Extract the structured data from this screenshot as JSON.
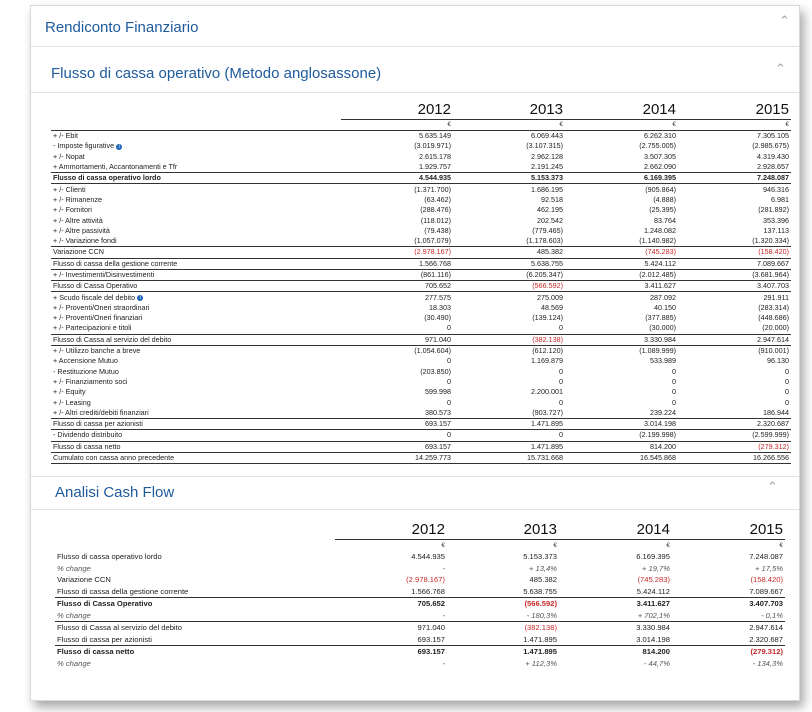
{
  "panel_title": "Rendiconto Finanziario",
  "section1_title": "Flusso di cassa operativo (Metodo anglosassone)",
  "section2_title": "Analisi Cash Flow",
  "years": [
    "2012",
    "2013",
    "2014",
    "2015"
  ],
  "currency": "€",
  "icons": {
    "collapse": "chevron-up-icon",
    "info": "info-icon"
  },
  "colors": {
    "header": "#1e5a9c",
    "negative": "#c62828"
  },
  "table1": [
    {
      "label": "+ /- Ebit",
      "v": [
        "5.635.149",
        "6.069.443",
        "6.262.310",
        "7.305.105"
      ],
      "tl": true
    },
    {
      "label": "- Imposte figurative",
      "info": true,
      "v": [
        "(3.019.971)",
        "(3.107.315)",
        "(2.755.005)",
        "(2.985.675)"
      ]
    },
    {
      "label": "+ /- Nopat",
      "v": [
        "2.615.178",
        "2.962.128",
        "3.507.305",
        "4.319.430"
      ]
    },
    {
      "label": "+ Ammortamenti, Accantonamenti e Tfr",
      "v": [
        "1.929.757",
        "2.191.245",
        "2.662.090",
        "2.928.657"
      ]
    },
    {
      "label": "Flusso di cassa operativo lordo",
      "v": [
        "4.544.935",
        "5.153.373",
        "6.169.395",
        "7.248.087"
      ],
      "b": true,
      "tl": true,
      "bl": true
    },
    {
      "label": "+ /- Clienti",
      "v": [
        "(1.371.700)",
        "1.686.195",
        "(905.864)",
        "946.316"
      ]
    },
    {
      "label": "+ /- Rimanenze",
      "v": [
        "(63.462)",
        "92.518",
        "(4.888)",
        "6.981"
      ]
    },
    {
      "label": "+ /- Fornitori",
      "v": [
        "(288.476)",
        "462.195",
        "(25.395)",
        "(281.892)"
      ]
    },
    {
      "label": "+ /- Altre attività",
      "v": [
        "(118.012)",
        "202.542",
        "83.764",
        "353.396"
      ]
    },
    {
      "label": "+ /- Altre passività",
      "v": [
        "(79.438)",
        "(779.465)",
        "1.248.082",
        "137.113"
      ]
    },
    {
      "label": "+ /- Variazione fondi",
      "v": [
        "(1.057.079)",
        "(1.178.603)",
        "(1.140.982)",
        "(1.320.334)"
      ]
    },
    {
      "label": "Variazione CCN",
      "v": [
        "(2.978.167)",
        "485.382",
        "(745.283)",
        "(158.420)"
      ],
      "neg": [
        true,
        false,
        true,
        true
      ],
      "tl": true,
      "bl": true
    },
    {
      "label": "Flusso di cassa della gestione corrente",
      "v": [
        "1.566.768",
        "5.638.755",
        "5.424.112",
        "7.089.667"
      ],
      "bl": true
    },
    {
      "label": "+ /- Investimenti/Disinvestimenti",
      "v": [
        "(861.116)",
        "(6.205.347)",
        "(2.012.485)",
        "(3.681.964)"
      ],
      "bl": true
    },
    {
      "label": "Flusso di Cassa Operativo",
      "v": [
        "705.652",
        "(566.592)",
        "3.411.627",
        "3.407.703"
      ],
      "neg": [
        false,
        true,
        false,
        false
      ],
      "bl": true
    },
    {
      "label": "+ Scudo fiscale del debito",
      "info": true,
      "v": [
        "277.575",
        "275.009",
        "287.092",
        "291.911"
      ]
    },
    {
      "label": "+ /- Proventi/Oneri straordinari",
      "v": [
        "18.303",
        "48.569",
        "40.150",
        "(283.314)"
      ]
    },
    {
      "label": "+ /- Proventi/Oneri finanziari",
      "v": [
        "(30.490)",
        "(139.124)",
        "(377.885)",
        "(448.686)"
      ]
    },
    {
      "label": "+ /- Partecipazioni e titoli",
      "v": [
        "0",
        "0",
        "(30.000)",
        "(20.000)"
      ]
    },
    {
      "label": "Flusso di Cassa al servizio del debito",
      "v": [
        "971.040",
        "(382.138)",
        "3.330.984",
        "2.947.614"
      ],
      "neg": [
        false,
        true,
        false,
        false
      ],
      "tl": true,
      "bl": true
    },
    {
      "label": "+ /- Utilizzo banche a breve",
      "v": [
        "(1.054.604)",
        "(612.120)",
        "(1.089.999)",
        "(910.001)"
      ]
    },
    {
      "label": "+ Accensione Mutuo",
      "v": [
        "0",
        "1.169.879",
        "533.989",
        "96.130"
      ]
    },
    {
      "label": "- Restituzione Mutuo",
      "v": [
        "(203.850)",
        "0",
        "0",
        "0"
      ]
    },
    {
      "label": "+ /- Finanziamento soci",
      "v": [
        "0",
        "0",
        "0",
        "0"
      ]
    },
    {
      "label": "+ /- Equity",
      "v": [
        "599.998",
        "2.200.001",
        "0",
        "0"
      ]
    },
    {
      "label": "+ /- Leasing",
      "v": [
        "0",
        "0",
        "0",
        "0"
      ]
    },
    {
      "label": "+ /- Altri crediti/debiti finanziari",
      "v": [
        "380.573",
        "(903.727)",
        "239.224",
        "186.944"
      ]
    },
    {
      "label": "Flusso di cassa per azionisti",
      "v": [
        "693.157",
        "1.471.895",
        "3.014.198",
        "2.320.687"
      ],
      "tl": true,
      "bl": true
    },
    {
      "label": "- Dividendo distribuito",
      "v": [
        "0",
        "0",
        "(2.199.998)",
        "(2.599.999)"
      ],
      "bl": true
    },
    {
      "label": "Flusso di cassa netto",
      "v": [
        "693.157",
        "1.471.895",
        "814.200",
        "(279.312)"
      ],
      "neg": [
        false,
        false,
        false,
        true
      ],
      "bl": true
    },
    {
      "label": "Cumulato con cassa anno precedente",
      "v": [
        "14.259.773",
        "15.731.668",
        "16.545.868",
        "16.266.556"
      ],
      "bl": true
    }
  ],
  "table2": [
    {
      "label": "Flusso di cassa operativo lordo",
      "v": [
        "4.544.935",
        "5.153.373",
        "6.169.395",
        "7.248.087"
      ]
    },
    {
      "label": "% change",
      "v": [
        "-",
        "+ 13,4%",
        "+ 19,7%",
        "+ 17,5%"
      ],
      "pc": true
    },
    {
      "label": "Variazione CCN",
      "v": [
        "(2.978.167)",
        "485.382",
        "(745.283)",
        "(158.420)"
      ],
      "neg": [
        true,
        false,
        true,
        true
      ]
    },
    {
      "label": "Flusso di cassa della gestione corrente",
      "v": [
        "1.566.768",
        "5.638.755",
        "5.424.112",
        "7.089.667"
      ],
      "bl": true
    },
    {
      "label": "Flusso di Cassa Operativo",
      "v": [
        "705.652",
        "(566.592)",
        "3.411.627",
        "3.407.703"
      ],
      "neg": [
        false,
        true,
        false,
        false
      ],
      "b": true
    },
    {
      "label": "% change",
      "v": [
        "-",
        "- 180,3%",
        "+ 702,1%",
        "- 0,1%"
      ],
      "pc": true,
      "neg": [
        false,
        true,
        false,
        true
      ],
      "bl": true
    },
    {
      "label": "Flusso di Cassa al servizio del debito",
      "v": [
        "971.040",
        "(382.138)",
        "3.330.984",
        "2.947.614"
      ],
      "neg": [
        false,
        true,
        false,
        false
      ]
    },
    {
      "label": "Flusso di cassa per azionisti",
      "v": [
        "693.157",
        "1.471.895",
        "3.014.198",
        "2.320.687"
      ],
      "bl": true
    },
    {
      "label": "Flusso di cassa netto",
      "v": [
        "693.157",
        "1.471.895",
        "814.200",
        "(279.312)"
      ],
      "neg": [
        false,
        false,
        false,
        true
      ],
      "b": true
    },
    {
      "label": "% change",
      "v": [
        "-",
        "+ 112,3%",
        "- 44,7%",
        "- 134,3%"
      ],
      "pc": true,
      "neg": [
        false,
        false,
        true,
        true
      ]
    }
  ]
}
